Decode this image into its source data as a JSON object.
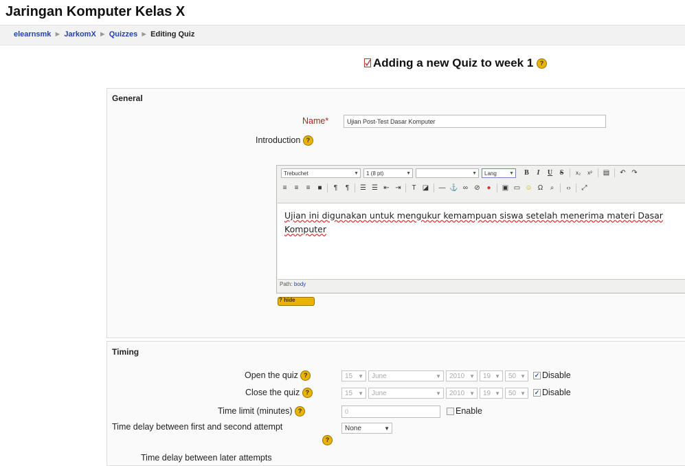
{
  "site_title": "Jaringan Komputer Kelas X",
  "breadcrumb": [
    "elearnsmk",
    "JarkomX",
    "Quizzes",
    "Editing Quiz"
  ],
  "breadcrumb_separator": "►",
  "page_heading": "Adding a new Quiz to week 1",
  "help_glyph": "?",
  "colors": {
    "link": "#2244aa",
    "required": "#b31f1f",
    "help_icon": "#e8b400"
  },
  "general": {
    "legend": "General",
    "name_label": "Name",
    "required_mark": "*",
    "name_value": "Ujian Post-Test Dasar Komputer",
    "intro_label": "Introduction",
    "editor": {
      "font_family": "Trebuchet",
      "font_size": "1 (8 pt)",
      "format": "",
      "lang": "Lang",
      "bold": "B",
      "italic": "I",
      "underline": "U",
      "strike": "S",
      "content": "Ujian ini digunakan untuk mengukur kemampuan siswa setelah menerima materi Dasar Komputer",
      "path_label": "Path:",
      "path_value": "body",
      "help_button_label": "? hide"
    }
  },
  "timing": {
    "legend": "Timing",
    "open_label": "Open the quiz",
    "close_label": "Close the quiz",
    "date": {
      "day": "15",
      "month": "June",
      "year": "2010",
      "hour": "19",
      "minute": "50"
    },
    "disable_label": "Disable",
    "disable_checked": true,
    "time_limit_label": "Time limit (minutes)",
    "time_limit_value": "0",
    "enable_label": "Enable",
    "enable_checked": false,
    "delay_first_label": "Time delay between first and second attempt",
    "delay_first_value": "None",
    "delay_later_label": "Time delay between later attempts"
  }
}
